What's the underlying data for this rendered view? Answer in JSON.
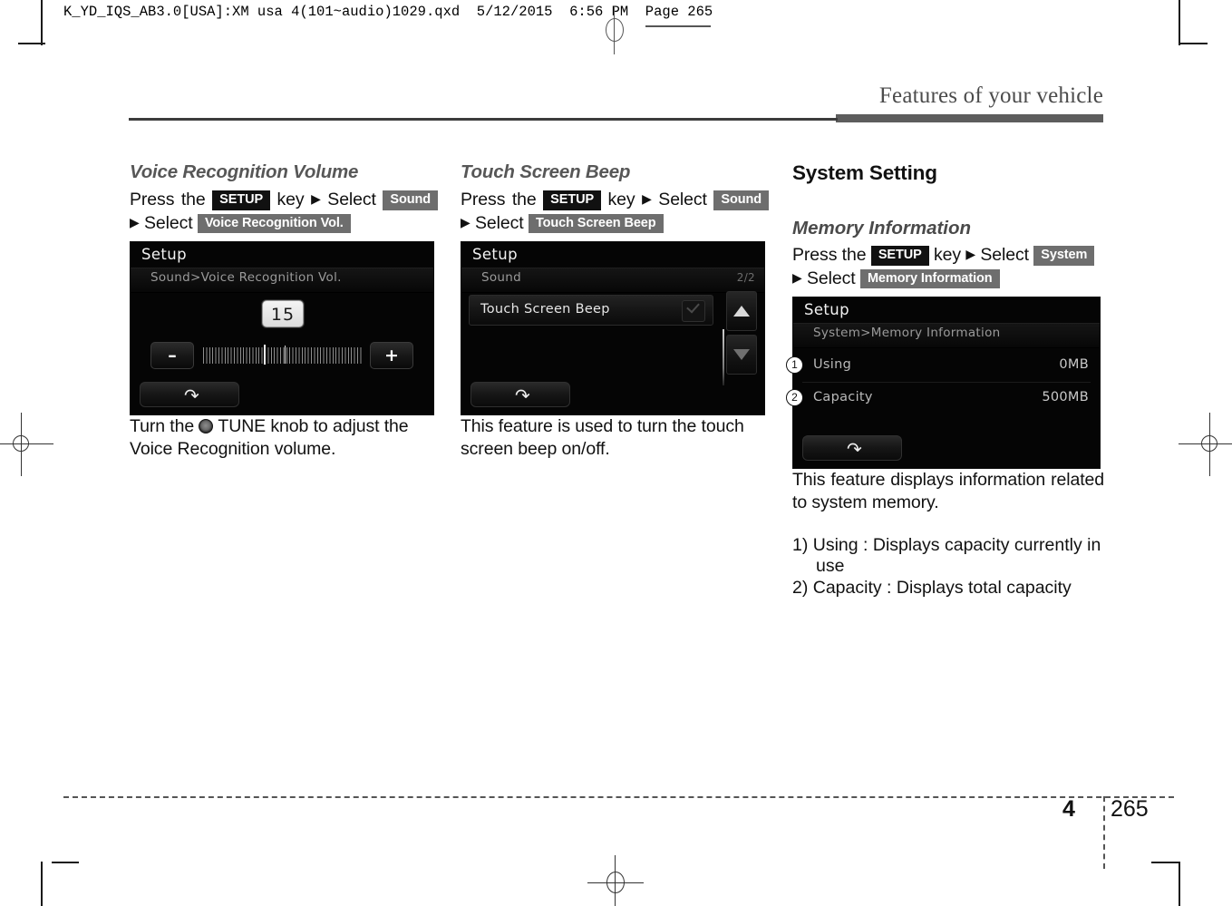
{
  "print": {
    "slug": "K_YD_IQS_AB3.0[USA]:XM usa 4(101~audio)1029.qxd  5/12/2015  6:56 PM  Page 265",
    "running_head": "Features of your vehicle",
    "chapter_number": "4",
    "page_number": "265"
  },
  "col1": {
    "heading": "Voice Recognition Volume",
    "instr_1": "Press the",
    "chip_setup": "SETUP",
    "instr_2": "key",
    "arrow": "▶",
    "instr_3": "Select",
    "chip_sound": "Sound",
    "instr_4": "Select",
    "chip_target": "Voice Recognition Vol.",
    "screen": {
      "title": "Setup",
      "breadcrumb": "Sound>Voice Recognition Vol.",
      "value": "15",
      "minus": "–",
      "plus": "+",
      "back_icon": "↶"
    },
    "body": "Turn the  TUNE knob to adjust the Voice Recognition volume.",
    "body_pre": "Turn the",
    "body_post": "TUNE knob to adjust the Voice Recognition volume."
  },
  "col2": {
    "heading": "Touch Screen Beep",
    "instr_1": "Press the",
    "chip_setup": "SETUP",
    "instr_2": "key",
    "arrow": "▶",
    "instr_3": "Select",
    "chip_sound": "Sound",
    "instr_4": "Select",
    "chip_target": "Touch Screen Beep",
    "screen": {
      "title": "Setup",
      "breadcrumb": "Sound",
      "page_indicator": "2/2",
      "row_label": "Touch Screen Beep",
      "back_icon": "↶"
    },
    "body": "This feature is used to turn the touch screen beep on/off."
  },
  "col3": {
    "section_heading": "System Setting",
    "heading": "Memory Information",
    "instr_1": "Press the",
    "chip_setup": "SETUP",
    "instr_2": "key",
    "arrow": "▶",
    "instr_3": "Select",
    "chip_system": "System",
    "instr_4": "Select",
    "chip_target": "Memory Information",
    "screen": {
      "title": "Setup",
      "breadcrumb": "System>Memory Information",
      "rows": [
        {
          "callout": "1",
          "key": "Using",
          "value": "0MB"
        },
        {
          "callout": "2",
          "key": "Capacity",
          "value": "500MB"
        }
      ],
      "back_icon": "↶"
    },
    "body": "This feature displays information related to system memory.",
    "notes": [
      "1) Using : Displays capacity currently in use",
      "2) Capacity : Displays total capacity"
    ]
  }
}
